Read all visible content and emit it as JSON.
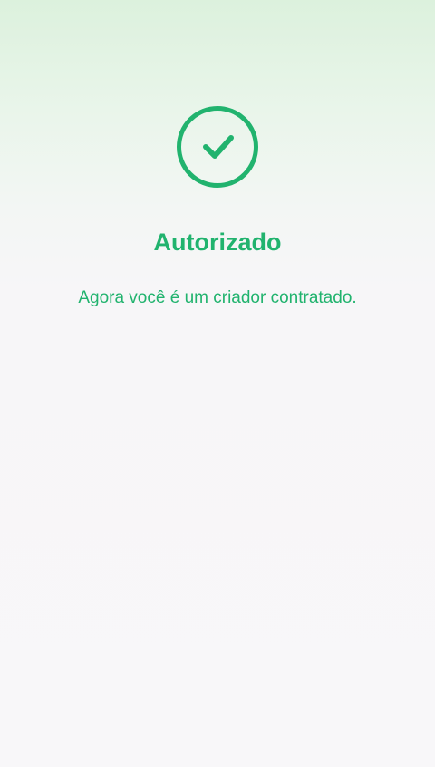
{
  "colors": {
    "accent": "#21b36e"
  },
  "status": {
    "icon": "check-circle-icon",
    "title": "Autorizado",
    "message": "Agora você é um criador contratado."
  }
}
